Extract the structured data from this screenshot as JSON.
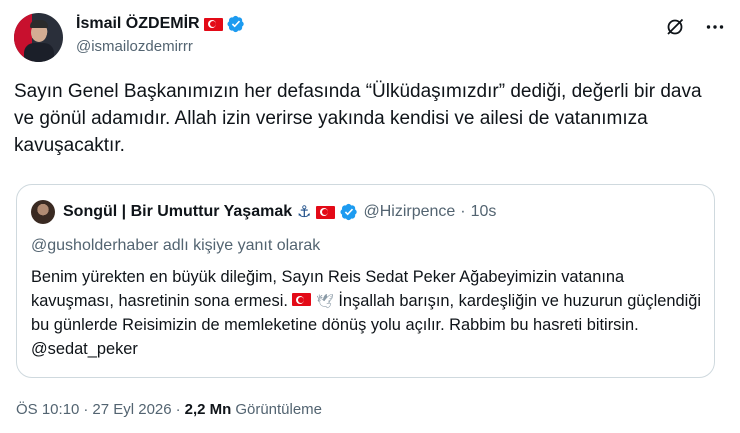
{
  "author": {
    "name": "İsmail ÖZDEMİR",
    "handle": "@ismailozdemirrr"
  },
  "tweet": {
    "text": "Sayın Genel Başkanımızın her defasında “Ülküdaşımızdır” dediği, değerli bir dava ve gönül adamıdır. Allah izin verirse yakında kendisi ve ailesi de vatanımıza kavuşacaktır."
  },
  "quote": {
    "name": "Songül | Bir Umuttur Yaşamak",
    "handle": "@Hizirpence",
    "dot": "·",
    "time": "10s",
    "reply_to": "@gusholderhaber adlı kişiye yanıt olarak",
    "text_part1": "Benim yürekten en büyük dileğim, Sayın Reis Sedat Peker Ağabeyimizin vatanına kavuşması, hasretinin sona ermesi.",
    "text_part2": "İnşallah barışın, kardeşliğin ve huzurun güçlendiği bu günlerde Reisimizin de memleketine dönüş yolu açılır. Rabbim bu hasreti bitirsin.  @sedat_peker"
  },
  "meta": {
    "time": "ÖS 10:10",
    "sep1": "·",
    "date": "27 Eyl 2026",
    "sep2": "·",
    "views": "2,2 Mn",
    "views_label": "Görüntüleme"
  },
  "icons": {
    "verified": "verified-badge-icon",
    "grok": "grok-icon",
    "more": "more-icon",
    "flag": "turkey-flag-icon",
    "anchor": "anchor-icon",
    "dove": "dove-icon"
  },
  "colors": {
    "verified": "#1d9bf0",
    "muted_text": "#536471",
    "border": "#cfd9de",
    "flag_red": "#e30a17"
  }
}
